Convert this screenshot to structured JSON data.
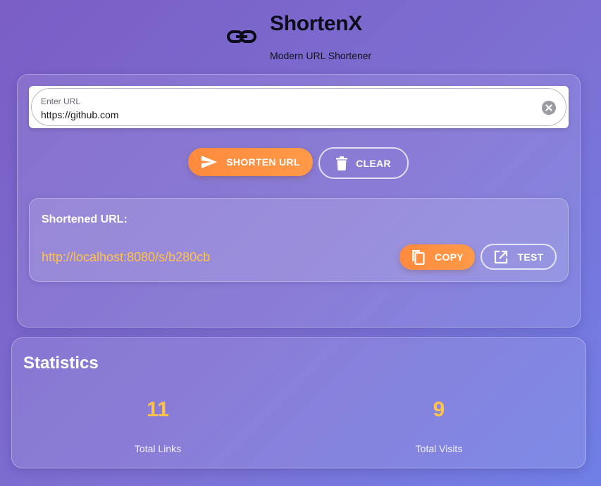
{
  "header": {
    "logo_icon": "link-icon",
    "title": "ShortenX",
    "subtitle": "Modern URL Shortener"
  },
  "form": {
    "url_label": "Enter URL",
    "url_value": "https://github.com",
    "clear_input_icon": "close-circle-icon"
  },
  "actions": {
    "shorten_label": "SHORTEN URL",
    "shorten_icon": "send-icon",
    "clear_label": "CLEAR",
    "clear_icon": "trash-icon"
  },
  "result": {
    "title": "Shortened URL:",
    "short_url": "http://localhost:8080/s/b280cb",
    "copy_label": "COPY",
    "copy_icon": "copy-icon",
    "test_label": "TEST",
    "test_icon": "open-in-new-icon"
  },
  "stats": {
    "title": "Statistics",
    "items": [
      {
        "value": "11",
        "label": "Total Links"
      },
      {
        "value": "9",
        "label": "Total Visits"
      }
    ]
  },
  "colors": {
    "accent_orange": "#ff8a3d",
    "highlight_yellow": "#ffc24a",
    "background_purple": "#7a5ec6",
    "background_blue": "#6f7fe6"
  }
}
